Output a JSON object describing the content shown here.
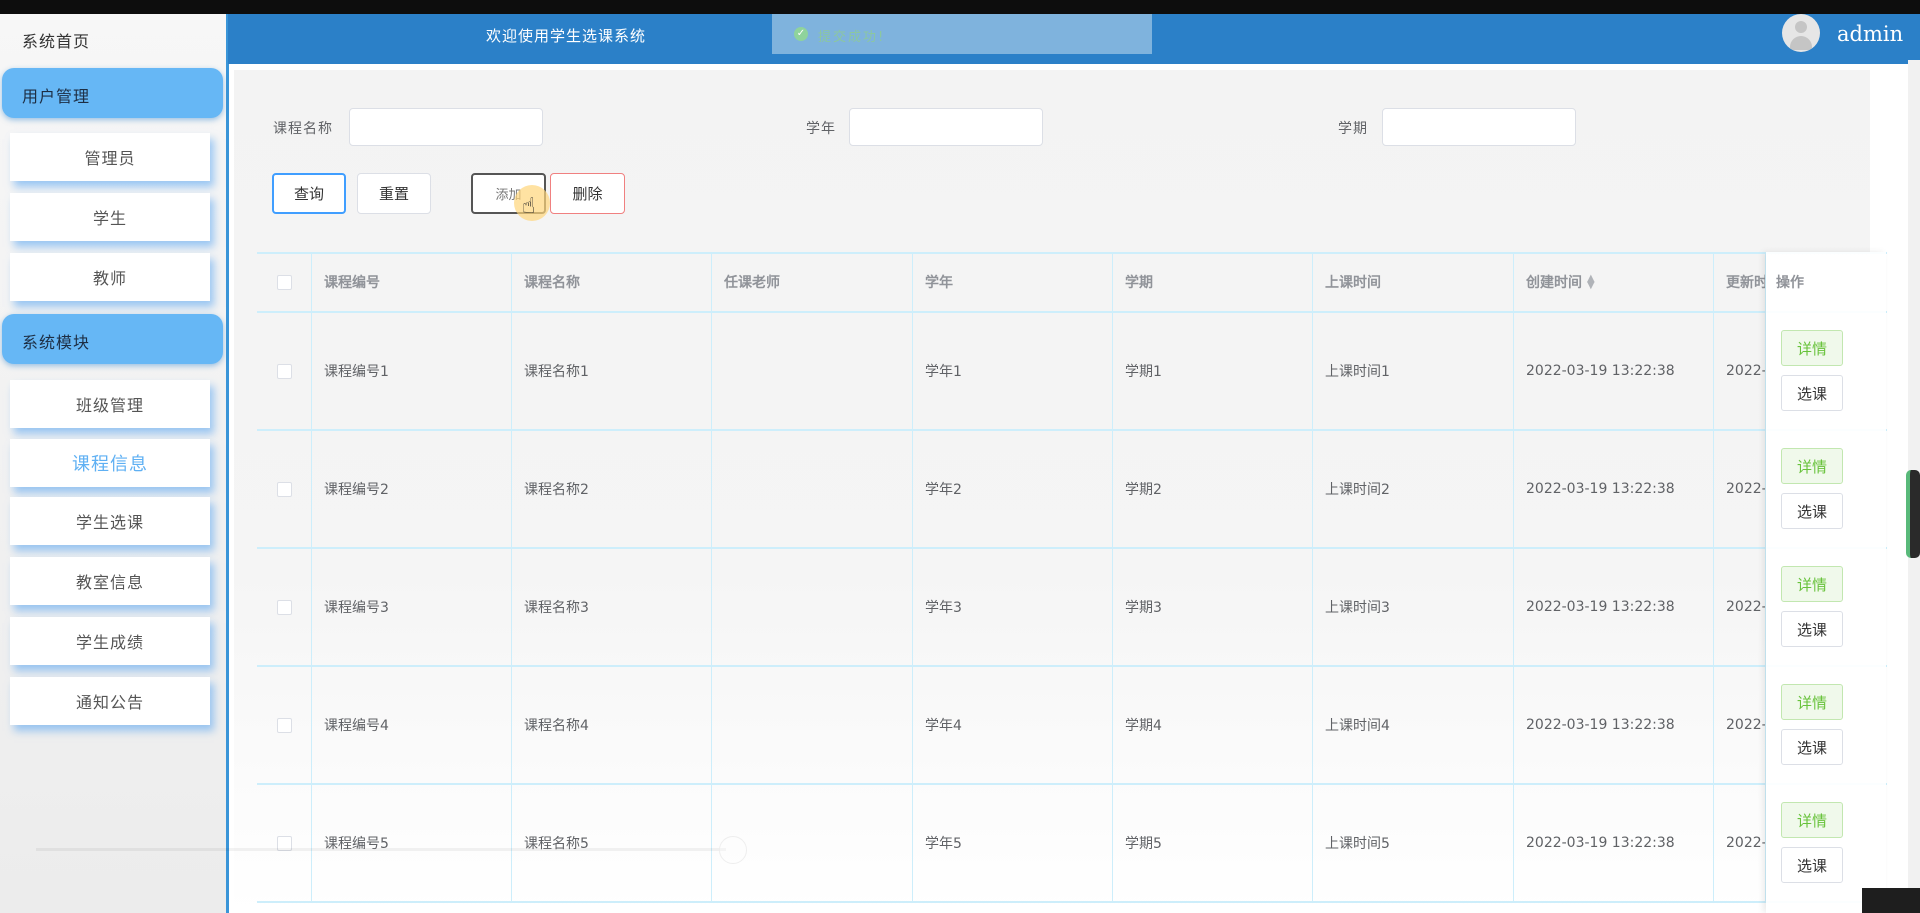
{
  "sidebar": {
    "home_label": "系统首页",
    "groups": [
      {
        "label": "用户管理",
        "items": [
          "管理员",
          "学生",
          "教师"
        ]
      },
      {
        "label": "系统模块",
        "items": [
          "班级管理",
          "课程信息",
          "学生选课",
          "教室信息",
          "学生成绩",
          "通知公告"
        ]
      }
    ],
    "active_item": "课程信息"
  },
  "header": {
    "welcome": "欢迎使用学生选课系统",
    "toast": "提交成功!",
    "username": "admin"
  },
  "search": {
    "fields": [
      {
        "label": "课程名称",
        "value": ""
      },
      {
        "label": "学年",
        "value": ""
      },
      {
        "label": "学期",
        "value": ""
      }
    ],
    "buttons": {
      "query": "查询",
      "reset": "重置",
      "add": "添加",
      "delete": "删除"
    }
  },
  "table": {
    "columns": [
      "课程编号",
      "课程名称",
      "任课老师",
      "学年",
      "学期",
      "上课时间",
      "创建时间",
      "更新时",
      "操作"
    ],
    "rows": [
      [
        "课程编号1",
        "课程名称1",
        "",
        "学年1",
        "学期1",
        "上课时间1",
        "2022-03-19 13:22:38",
        "2022-"
      ],
      [
        "课程编号2",
        "课程名称2",
        "",
        "学年2",
        "学期2",
        "上课时间2",
        "2022-03-19 13:22:38",
        "2022-"
      ],
      [
        "课程编号3",
        "课程名称3",
        "",
        "学年3",
        "学期3",
        "上课时间3",
        "2022-03-19 13:22:38",
        "2022-"
      ],
      [
        "课程编号4",
        "课程名称4",
        "",
        "学年4",
        "学期4",
        "上课时间4",
        "2022-03-19 13:22:38",
        "2022-"
      ],
      [
        "课程编号5",
        "课程名称5",
        "",
        "学年5",
        "学期5",
        "上课时间5",
        "2022-03-19 13:22:38",
        "2022-"
      ]
    ],
    "row_actions": {
      "detail": "详情",
      "select": "选课"
    }
  }
}
